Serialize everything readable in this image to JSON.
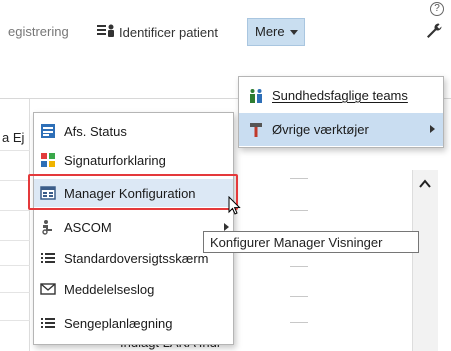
{
  "toolbar": {
    "help_glyph": "?",
    "registrering_label": "egistrering",
    "identificer_label": "Identificer patient",
    "mere_label": "Mere"
  },
  "background": {
    "left_edge_text": "a Ej",
    "bottom_text": "Indlagt LAKA   Indl"
  },
  "menu_left": {
    "items": [
      {
        "label": "Afs. Status",
        "icon": "status-list-icon"
      },
      {
        "label": "Signaturforklaring",
        "icon": "signature-legend-icon"
      },
      {
        "label": "Manager Konfiguration",
        "icon": "manager-config-icon"
      },
      {
        "label": "ASCOM",
        "icon": "ascom-icon"
      },
      {
        "label": "Standardoversigtsskærm",
        "icon": "list-icon"
      },
      {
        "label": "Meddelelseslog",
        "icon": "message-icon"
      },
      {
        "label": "Sengeplanlægning",
        "icon": "list-icon"
      }
    ]
  },
  "menu_right": {
    "items": [
      {
        "label": "Sundhedsfaglige teams",
        "icon": "teams-icon"
      },
      {
        "label": "Øvrige værktøjer",
        "icon": "tools-icon"
      }
    ]
  },
  "tooltip": {
    "text": "Konfigurer Manager Visninger"
  },
  "colors": {
    "highlight_border": "#e4393b",
    "hover_bg": "#dce8f5",
    "mere_bg": "#c9def0"
  }
}
